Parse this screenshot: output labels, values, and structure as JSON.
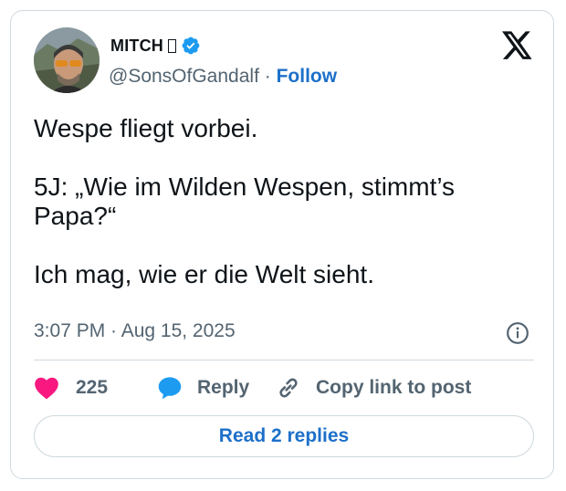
{
  "author": {
    "display_name": "MITCH",
    "handle": "@SonsOfGandalf",
    "separator": "·",
    "follow_label": "Follow"
  },
  "tweet": {
    "line1": "Wespe fliegt vorbei.",
    "line2": "5J: „Wie im Wilden Wespen, stimmt’s",
    "line3": "Papa?“",
    "line4": "Ich mag, wie er die Welt sieht."
  },
  "timestamp": "3:07 PM · Aug 15, 2025",
  "actions": {
    "like_count": "225",
    "reply_label": "Reply",
    "copy_link_label": "Copy link to post"
  },
  "read_replies_label": "Read 2 replies",
  "colors": {
    "text": "#0f1419",
    "muted": "#536471",
    "link": "#1d70c9",
    "like": "#f91880",
    "reply": "#1d9bf0",
    "border": "#cfd9de"
  },
  "icons": [
    "verified-badge-icon",
    "x-logo-icon",
    "info-icon",
    "heart-icon",
    "reply-bubble-icon",
    "link-icon"
  ]
}
